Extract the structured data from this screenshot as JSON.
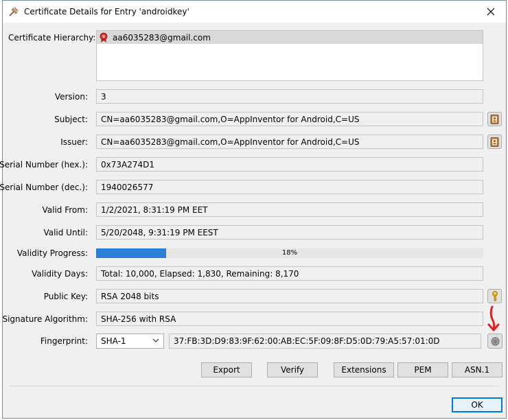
{
  "window": {
    "title": "Certificate Details for Entry 'androidkey'"
  },
  "labels": {
    "hierarchy": "Certificate Hierarchy:",
    "version": "Version:",
    "subject": "Subject:",
    "issuer": "Issuer:",
    "serial_hex": "Serial Number (hex.):",
    "serial_dec": "Serial Number (dec.):",
    "valid_from": "Valid From:",
    "valid_until": "Valid Until:",
    "validity_progress": "Validity Progress:",
    "validity_days": "Validity Days:",
    "public_key": "Public Key:",
    "signature_algorithm": "Signature Algorithm:",
    "fingerprint": "Fingerprint:"
  },
  "values": {
    "hierarchy_item": "aa6035283@gmail.com",
    "version": "3",
    "subject": "CN=aa6035283@gmail.com,O=AppInventor for Android,C=US",
    "issuer": "CN=aa6035283@gmail.com,O=AppInventor for Android,C=US",
    "serial_hex": "0x73A274D1",
    "serial_dec": "1940026577",
    "valid_from": "1/2/2021, 8:31:19 PM EET",
    "valid_until": "5/20/2048, 9:31:19 PM EEST",
    "validity_progress_label": "18%",
    "validity_progress": 0.18,
    "validity_days": "Total: 10,000, Elapsed: 1,830, Remaining: 8,170",
    "public_key": "RSA 2048 bits",
    "signature_algorithm": "SHA-256 with RSA",
    "fingerprint_algorithm": "SHA-1",
    "fingerprint": "37:FB:3D:D9:83:9F:62:00:AB:EC:5F:09:8F:D5:0D:79:A5:57:01:0D"
  },
  "buttons": {
    "export": "Export",
    "verify": "Verify",
    "extensions": "Extensions",
    "pem": "PEM",
    "asn1": "ASN.1",
    "ok": "OK"
  },
  "icons": {
    "app": "keystore-tool-icon",
    "certificate": "certificate-ribbon-icon",
    "details": "address-book-icon",
    "key": "key-icon",
    "fingerprint": "fingerprint-icon",
    "close": "close-icon"
  },
  "colors": {
    "progress_fill": "#2b7fd6",
    "annotation_arrow": "#e02020",
    "ok_border": "#0078d7"
  }
}
